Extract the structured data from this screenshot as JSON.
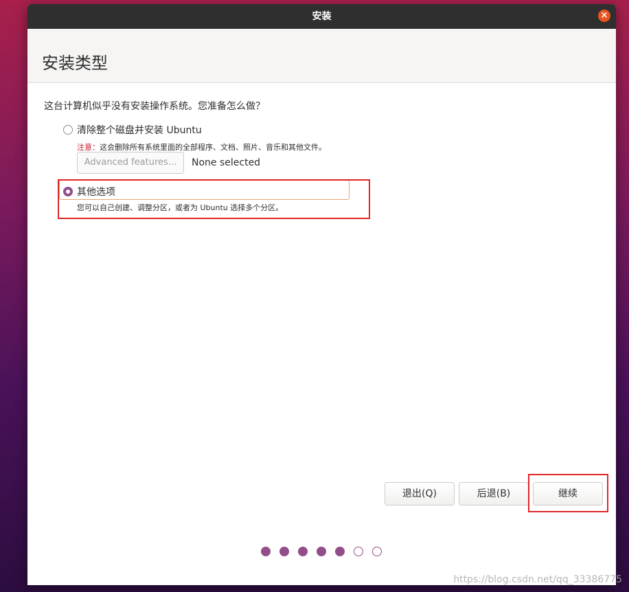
{
  "window": {
    "title": "安装",
    "close_label": "×"
  },
  "header": {
    "title": "安装类型"
  },
  "main": {
    "question": "这台计算机似乎没有安装操作系统。您准备怎么做？",
    "option_erase": {
      "label": "清除整个磁盘并安装 Ubuntu",
      "checked": false,
      "warning_strong": "注意：",
      "warning_text": "这会删除所有系统里面的全部程序、文档、照片、音乐和其他文件。",
      "advanced_button": "Advanced features...",
      "advanced_status": "None selected"
    },
    "option_other": {
      "label": "其他选项",
      "checked": true,
      "description": "您可以自己创建、调整分区，或者为 Ubuntu 选择多个分区。"
    }
  },
  "buttons": {
    "quit": "退出(Q)",
    "back": "后退(B)",
    "continue": "继续"
  },
  "progress": {
    "total_steps": 7,
    "completed_steps": 5
  },
  "watermark": "https://blog.csdn.net/qq_33386775",
  "colors": {
    "accent": "#924d8b",
    "close": "#e95420",
    "annotation": "#e02424",
    "warning": "#c7162b"
  }
}
